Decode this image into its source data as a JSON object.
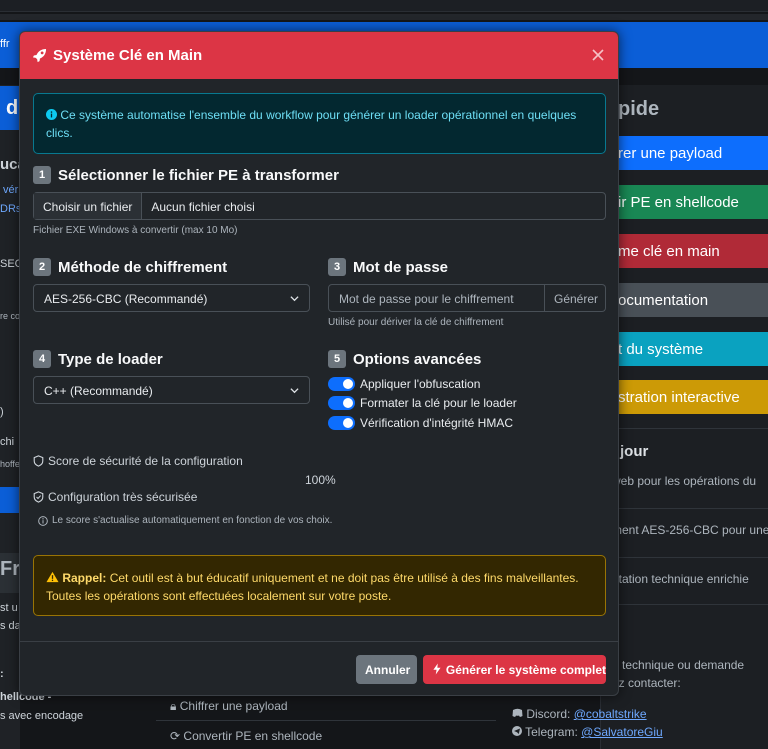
{
  "background": {
    "right_panel_header": "pide",
    "right_buttons": [
      {
        "label": "rer une payload",
        "color": "#0d6efd"
      },
      {
        "label": "ir PE en shellcode",
        "color": "#198754"
      },
      {
        "label": "me clé en main",
        "color": "#b02a37"
      },
      {
        "label": "ocumentation",
        "color": "#495057"
      },
      {
        "label": "t du système",
        "color": "#0aa2c0"
      },
      {
        "label": "stration interactive",
        "color": "#cc9a06"
      }
    ],
    "right_section_title": "jour",
    "right_texts": [
      "web pour les opérations du",
      "ment AES-256-CBC pour une",
      "ntation technique enrichie",
      "e technique ou demande",
      "ez contacter:"
    ],
    "contacts": [
      {
        "label": "Discord:",
        "handle": "@cobaltstrike"
      },
      {
        "label": "Telegram:",
        "handle": "@SalvatoreGiu"
      }
    ],
    "bottom_items": [
      "Chiffrer une payload",
      "Convertir PE en shellcode"
    ],
    "left_texts": [
      "ffr",
      "d",
      "uca",
      "vér",
      "DRs",
      "SEC",
      "re co",
      ")",
      "chi",
      "hoffe",
      "Fra",
      "st u",
      "s da",
      ":",
      "hellcode -",
      "s avec encodage"
    ]
  },
  "modal": {
    "title": "Système Clé en Main",
    "info": "Ce système automatise l'ensemble du workflow pour générer un loader opérationnel en quelques clics.",
    "step1": {
      "num": "1",
      "label": "Sélectionner le fichier PE à transformer",
      "file_button": "Choisir un fichier",
      "file_name": "Aucun fichier choisi",
      "help": "Fichier EXE Windows à convertir (max 10 Mo)"
    },
    "step2": {
      "num": "2",
      "label": "Méthode de chiffrement",
      "selected": "AES-256-CBC (Recommandé)"
    },
    "step3": {
      "num": "3",
      "label": "Mot de passe",
      "placeholder": "Mot de passe pour le chiffrement",
      "generate": "Générer",
      "help": "Utilisé pour dériver la clé de chiffrement"
    },
    "step4": {
      "num": "4",
      "label": "Type de loader",
      "selected": "C++ (Recommandé)"
    },
    "step5": {
      "num": "5",
      "label": "Options avancées",
      "options": [
        "Appliquer l'obfuscation",
        "Formater la clé pour le loader",
        "Vérification d'intégrité HMAC"
      ],
      "checked": [
        true,
        true,
        true
      ]
    },
    "score_label": "Score de sécurité de la configuration",
    "score_value": "100%",
    "score_status": "Configuration très sécurisée",
    "score_note": "Le score s'actualise automatiquement en fonction de vos choix.",
    "warning_bold": "Rappel:",
    "warning_text": "Cet outil est à but éducatif uniquement et ne doit pas être utilisé à des fins malveillantes. Toutes les opérations sont effectuées localement sur votre poste.",
    "cancel": "Annuler",
    "generate_all": "Générer le système complet"
  },
  "colors": {
    "header_red": "#dc3545",
    "info_text": "#6edff6",
    "warning_text": "#ffda6a",
    "switch_blue": "#0d6efd"
  }
}
